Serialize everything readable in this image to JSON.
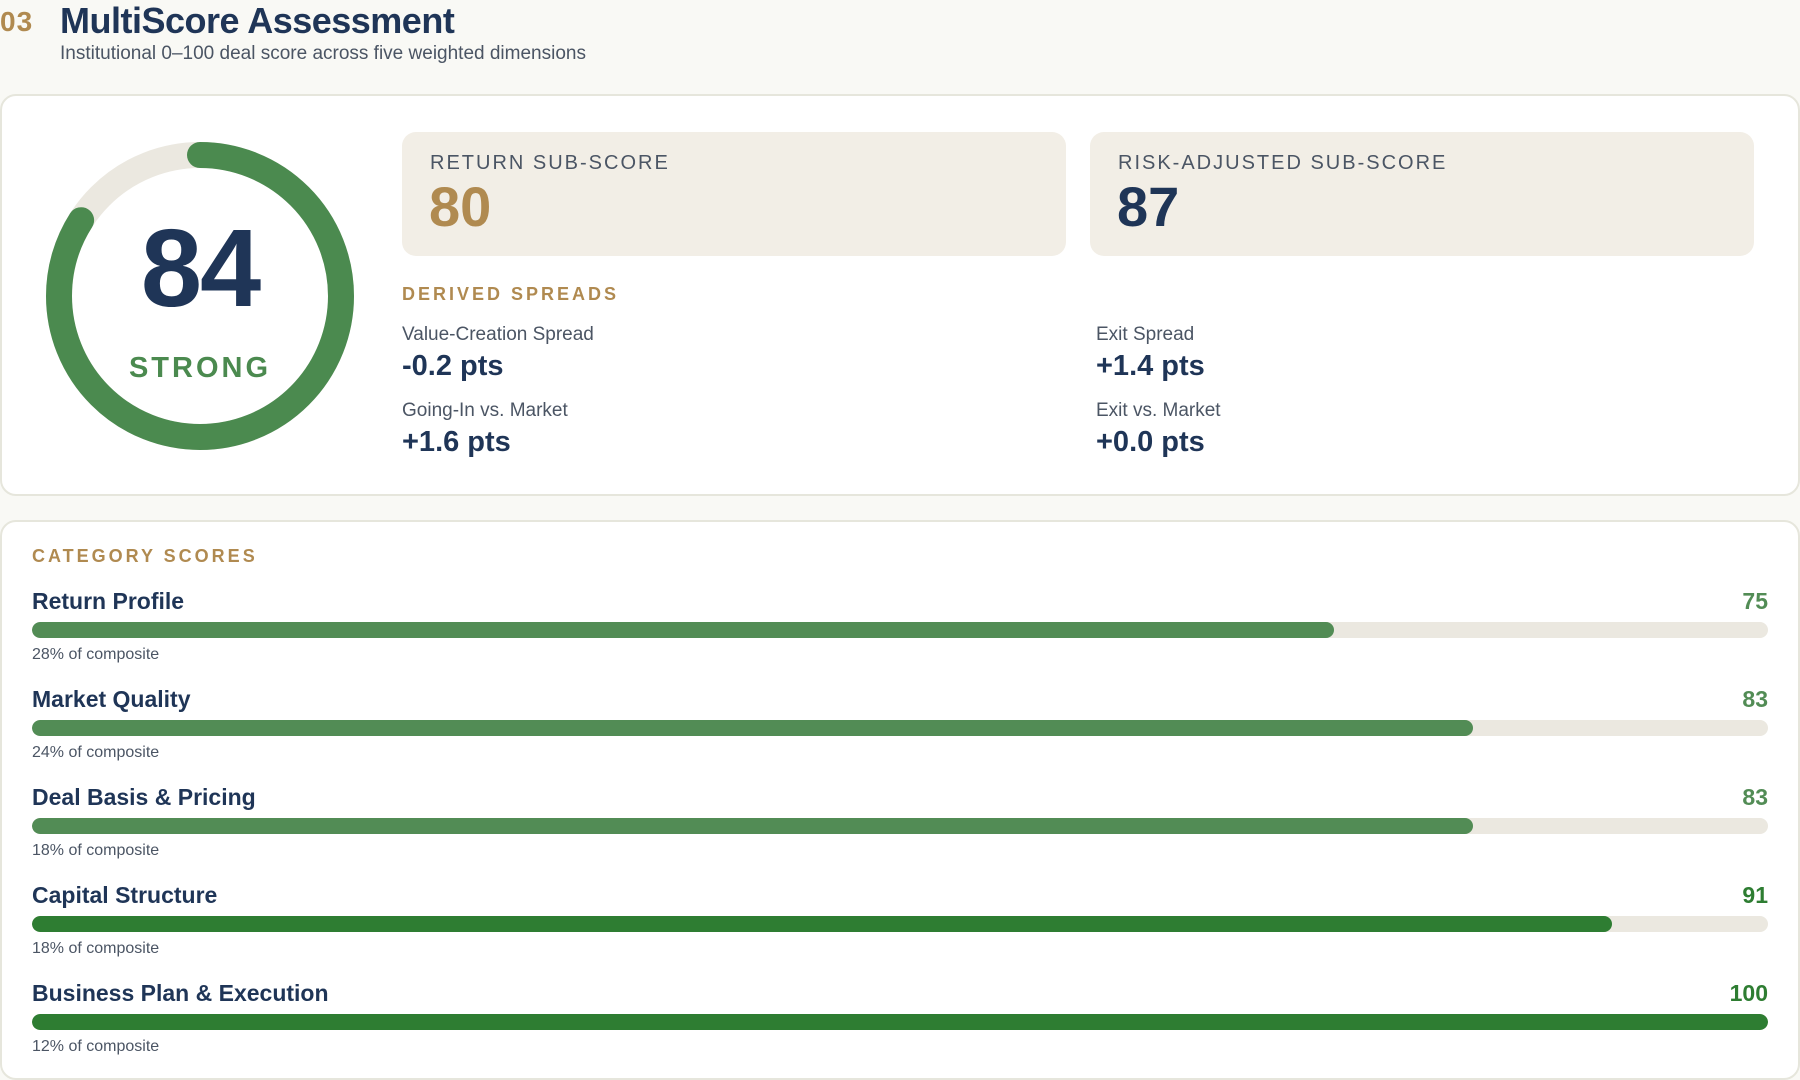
{
  "header": {
    "section_number": "03",
    "title": "MultiScore Assessment",
    "subtitle": "Institutional 0–100 deal score across five weighted dimensions"
  },
  "composite": {
    "score": "84",
    "score_value": 84,
    "rating": "STRONG",
    "ring_color": "#4b8a4f",
    "track_color": "#ebe8e0"
  },
  "sub_scores": [
    {
      "label": "RETURN SUB-SCORE",
      "value": "80"
    },
    {
      "label": "RISK-ADJUSTED SUB-SCORE",
      "value": "87"
    }
  ],
  "derived": {
    "heading": "DERIVED SPREADS",
    "metrics": [
      {
        "label": "Value-Creation Spread",
        "value": "-0.2 pts"
      },
      {
        "label": "Exit Spread",
        "value": "+1.4 pts"
      },
      {
        "label": "Going-In vs. Market",
        "value": "+1.6 pts"
      },
      {
        "label": "Exit vs. Market",
        "value": "+0.0 pts"
      }
    ]
  },
  "categories": {
    "heading": "CATEGORY SCORES",
    "items": [
      {
        "name": "Return Profile",
        "score": "75",
        "score_value": 75,
        "weight": "28% of composite",
        "color": "#528c55"
      },
      {
        "name": "Market Quality",
        "score": "83",
        "score_value": 83,
        "weight": "24% of composite",
        "color": "#528c55"
      },
      {
        "name": "Deal Basis & Pricing",
        "score": "83",
        "score_value": 83,
        "weight": "18% of composite",
        "color": "#528c55"
      },
      {
        "name": "Capital Structure",
        "score": "91",
        "score_value": 91,
        "weight": "18% of composite",
        "color": "#2e7d32"
      },
      {
        "name": "Business Plan & Execution",
        "score": "100",
        "score_value": 100,
        "weight": "12% of composite",
        "color": "#2e7d32"
      }
    ]
  },
  "colors": {
    "accent_gold": "#b08a50",
    "navy": "#1f3557",
    "green": "#4b8a4f"
  }
}
